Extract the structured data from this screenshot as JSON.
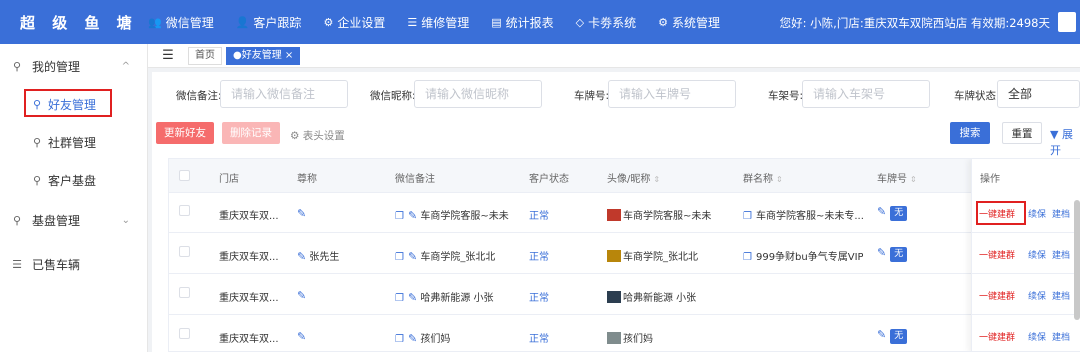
{
  "app": {
    "brand": "超 级 鱼 塘"
  },
  "topnav": [
    {
      "icon": "👥",
      "label": "微信管理"
    },
    {
      "icon": "👤",
      "label": "客户跟踪"
    },
    {
      "icon": "⚙",
      "label": "企业设置"
    },
    {
      "icon": "☰",
      "label": "维修管理"
    },
    {
      "icon": "▤",
      "label": "统计报表"
    },
    {
      "icon": "◇",
      "label": "卡劵系统"
    },
    {
      "icon": "⚙",
      "label": "系统管理"
    }
  ],
  "user": {
    "info": "您好: 小陈,门店:重庆双车双院西站店 有效期:2498天"
  },
  "sidebar": [
    {
      "icon": "⚲",
      "label": "我的管理",
      "chevron": "^"
    },
    {
      "icon": "⚲",
      "label": "好友管理"
    },
    {
      "icon": "⚲",
      "label": "社群管理"
    },
    {
      "icon": "⚲",
      "label": "客户基盘"
    },
    {
      "icon": "⚲",
      "label": "基盘管理",
      "chevron": "⌄"
    },
    {
      "icon": "☰",
      "label": "已售车辆"
    }
  ],
  "tabs": {
    "fold_icon": "☰",
    "home": "首页",
    "active": "●好友管理 ×"
  },
  "filters": {
    "wechat_note_label": "微信备注:",
    "wechat_note_placeholder": "请输入微信备注",
    "wechat_nick_label": "微信昵称:",
    "wechat_nick_placeholder": "请输入微信昵称",
    "plate_label": "车牌号:",
    "plate_placeholder": "请输入车牌号",
    "rack_label": "车架号:",
    "rack_placeholder": "请输入车架号",
    "plate_status_label": "车牌状态:",
    "plate_status_value": "全部"
  },
  "toolbar": {
    "update": "更新好友",
    "delete": "删除记录",
    "settings": "⚙ 表头设置",
    "search": "搜索",
    "reset": "重置",
    "expand": "▼ 展开"
  },
  "columns": {
    "store": "门店",
    "nickname": "尊称",
    "note": "微信备注",
    "status": "客户状态",
    "avatar": "头像/昵称",
    "group": "群名称",
    "plate": "车牌号",
    "ops": "操作"
  },
  "sort_icon": "⇕",
  "rows": [
    {
      "store": "重庆双车双...",
      "nickname": "",
      "note": "车商学院客服~未未",
      "status": "正常",
      "avatar": "车商学院客服~未未",
      "group": "车商学院客服~未未专...",
      "plate": "无"
    },
    {
      "store": "重庆双车双...",
      "nickname": "张先生",
      "note": "车商学院_张北北",
      "status": "正常",
      "avatar": "车商学院_张北北",
      "group": "999争财bu争气专属VIP...",
      "plate": "无"
    },
    {
      "store": "重庆双车双...",
      "nickname": "",
      "note": "哈弗新能源 小张",
      "status": "正常",
      "avatar": "哈弗新能源 小张",
      "group": "",
      "plate": "无"
    },
    {
      "store": "重庆双车双...",
      "nickname": "",
      "note": "孩们妈",
      "status": "正常",
      "avatar": "孩们妈",
      "group": "",
      "plate": "无"
    }
  ],
  "ops": {
    "build_group": "一键建群",
    "renew": "续保",
    "archive": "建档"
  },
  "icons": {
    "edit": "✎",
    "copy": "❐"
  },
  "colors": {
    "primary": "#3a6fd8",
    "danger": "#f56c6c",
    "highlight": "#e02020"
  }
}
